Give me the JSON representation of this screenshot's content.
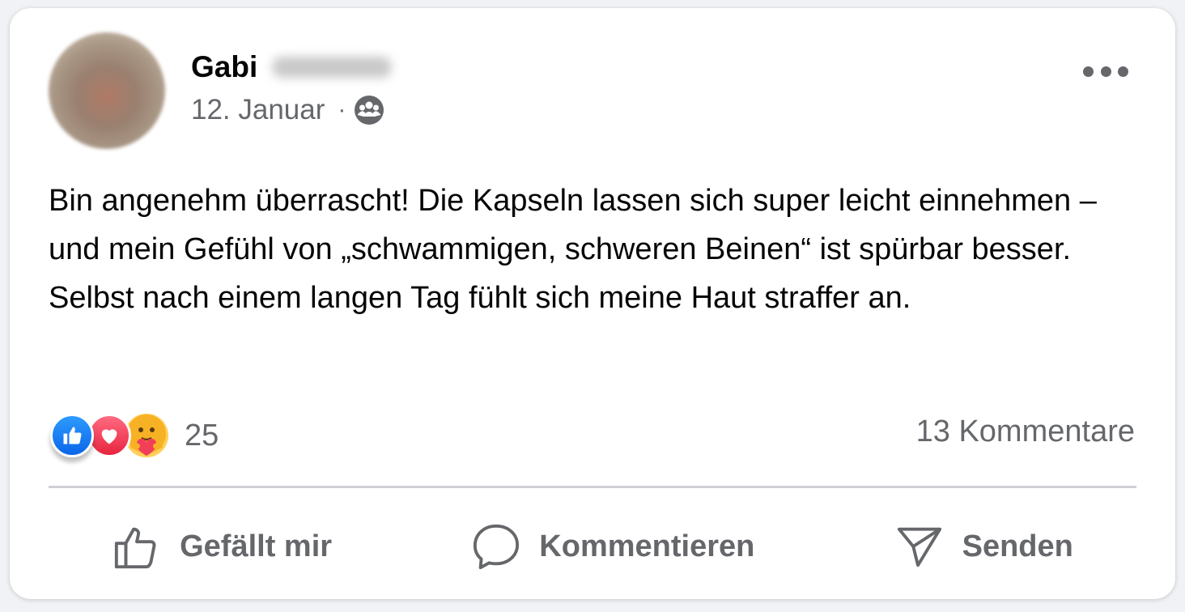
{
  "post": {
    "author_name": "Gabi",
    "date": "12. Januar",
    "separator": "·",
    "audience_icon": "friends-icon",
    "body": "Bin angenehm überrascht! Die Kapseln lassen sich super leicht einnehmen – und mein Gefühl von „schwammigen, schweren Beinen“ ist spürbar besser. Selbst nach einem langen Tag fühlt sich meine Haut straffer an."
  },
  "reactions": {
    "types": [
      "like",
      "love",
      "care"
    ],
    "count": "25"
  },
  "comments": {
    "label": "13 Kommentare"
  },
  "actions": {
    "like_label": "Gefällt mir",
    "comment_label": "Kommentieren",
    "send_label": "Senden"
  },
  "colors": {
    "like": "#1877f2",
    "love": "#f33e58",
    "care": "#f7b125",
    "secondary_text": "#65676b"
  }
}
